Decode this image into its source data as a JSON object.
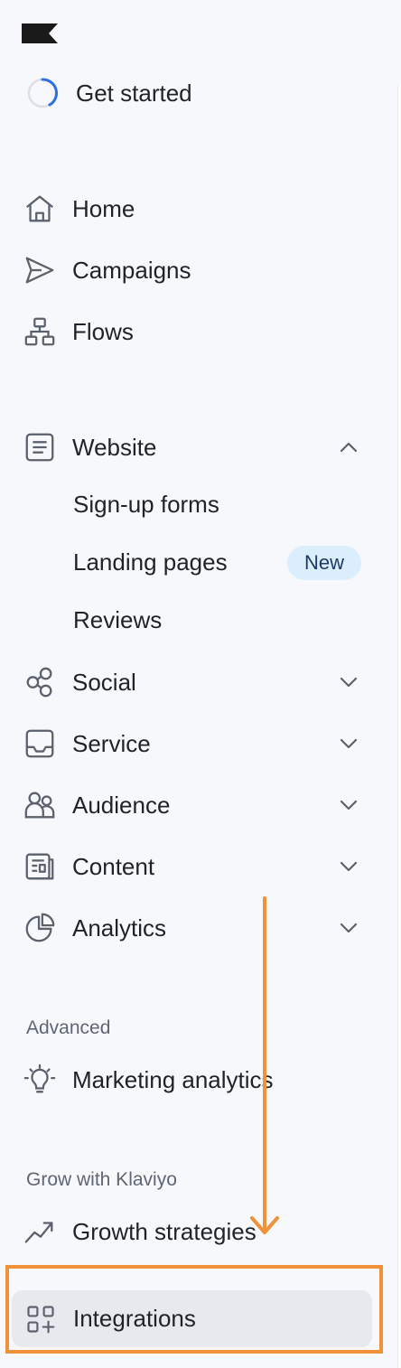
{
  "colors": {
    "background": "#f7f8fb",
    "accent_blue": "#2f6fe0",
    "badge_bg": "#dbeefc",
    "selected_bg": "#e8e9ee",
    "annotation_orange": "#f0923a"
  },
  "brand": {
    "logo": "klaviyo-flag-logo"
  },
  "get_started": {
    "label": "Get started",
    "icon": "progress-ring-icon"
  },
  "primary_nav": [
    {
      "label": "Home",
      "icon": "home-icon"
    },
    {
      "label": "Campaigns",
      "icon": "send-icon"
    },
    {
      "label": "Flows",
      "icon": "flow-icon"
    }
  ],
  "channels": {
    "website": {
      "label": "Website",
      "icon": "document-icon",
      "expanded": true,
      "children": [
        {
          "label": "Sign-up forms"
        },
        {
          "label": "Landing pages",
          "badge": "New"
        },
        {
          "label": "Reviews"
        }
      ]
    },
    "collapsed": [
      {
        "label": "Social",
        "icon": "social-icon"
      },
      {
        "label": "Service",
        "icon": "inbox-icon"
      },
      {
        "label": "Audience",
        "icon": "audience-icon"
      },
      {
        "label": "Content",
        "icon": "content-icon"
      },
      {
        "label": "Analytics",
        "icon": "pie-chart-icon"
      }
    ]
  },
  "advanced": {
    "heading": "Advanced",
    "items": [
      {
        "label": "Marketing analytics",
        "icon": "lightbulb-icon"
      }
    ]
  },
  "grow": {
    "heading": "Grow with Klaviyo",
    "items": [
      {
        "label": "Growth strategies",
        "icon": "trend-up-icon"
      },
      {
        "label": "Integrations",
        "icon": "integrations-icon",
        "selected": true
      }
    ]
  }
}
